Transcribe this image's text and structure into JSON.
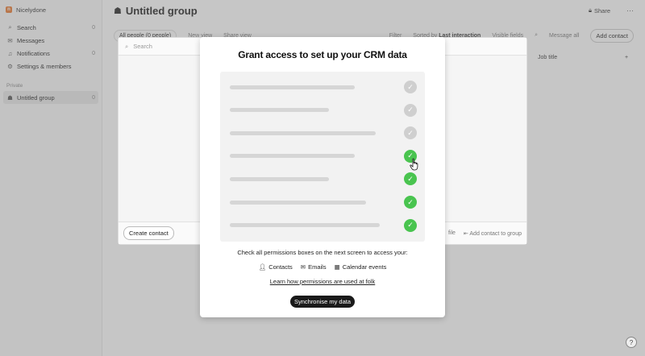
{
  "workspace": {
    "name": "Nicelydone",
    "logo": "n"
  },
  "sidebar": {
    "items": [
      {
        "icon": "search-icon",
        "label": "Search",
        "count": "0"
      },
      {
        "icon": "message-icon",
        "label": "Messages",
        "count": ""
      },
      {
        "icon": "bell-icon",
        "label": "Notifications",
        "count": "0"
      },
      {
        "icon": "gear-icon",
        "label": "Settings & members",
        "count": ""
      }
    ],
    "section_private": "Private",
    "group": {
      "icon": "group-icon",
      "label": "Untitled group",
      "count": "0"
    }
  },
  "header": {
    "title": "Untitled group",
    "share_label": "Share",
    "more_label": "···"
  },
  "toolbar": {
    "view_label": "All people (0 people)",
    "new_view": "New view",
    "share_view": "Share view",
    "filter": "Filter",
    "sorted_by": "Sorted by",
    "sort_value": "Last interaction",
    "visible_fields": "Visible fields",
    "message_all": "Message all",
    "add_contact": "Add contact"
  },
  "table": {
    "job_title_header": "Job title"
  },
  "popover": {
    "search_placeholder": "Search",
    "create_contact": "Create contact",
    "file_label": "file",
    "add_to_group": "Add contact to group"
  },
  "modal": {
    "title": "Grant access to set up your CRM data",
    "permission_rows": [
      {
        "bar_fraction": 0.67,
        "checked": false
      },
      {
        "bar_fraction": 0.53,
        "checked": false
      },
      {
        "bar_fraction": 0.78,
        "checked": false
      },
      {
        "bar_fraction": 0.67,
        "checked": true
      },
      {
        "bar_fraction": 0.53,
        "checked": true
      },
      {
        "bar_fraction": 0.73,
        "checked": true
      },
      {
        "bar_fraction": 0.8,
        "checked": true
      }
    ],
    "hint": "Check all permissions boxes on the next screen to access your:",
    "permissions": [
      {
        "icon": "person-icon",
        "label": "Contacts"
      },
      {
        "icon": "mail-icon",
        "label": "Emails"
      },
      {
        "icon": "calendar-icon",
        "label": "Calendar events"
      }
    ],
    "learn_link": "Learn how permissions are used at folk",
    "sync_button": "Synchronise my data"
  },
  "colors": {
    "check_green": "#49c44f",
    "check_grey": "#cfcfcf",
    "brand": "#e8772e"
  }
}
